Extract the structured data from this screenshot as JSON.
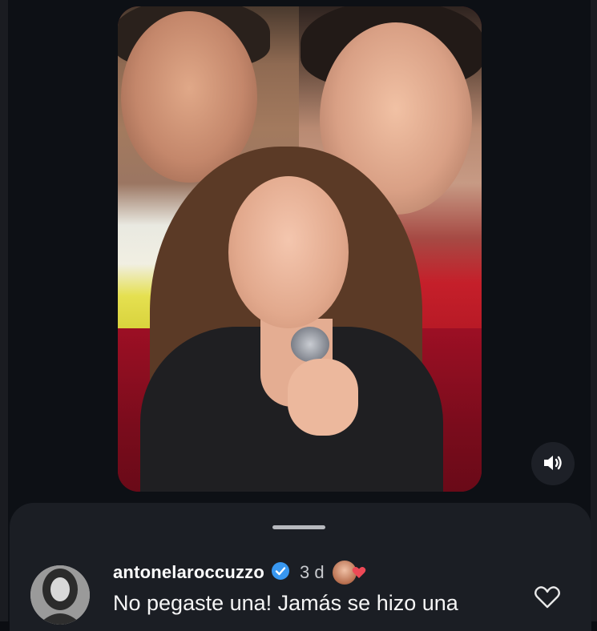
{
  "comment": {
    "username": "antonelaroccuzzo",
    "time": "3 d",
    "text": "No pegaste una! Jamás se hizo una"
  },
  "icons": {
    "sound": "speaker-icon",
    "verified": "verified-badge-icon",
    "like": "heart-outline-icon",
    "reaction": "heart-icon"
  },
  "colors": {
    "background": "#0d1015",
    "sheet": "#1b1e24",
    "verified": "#3897f0",
    "reaction_heart": "#ed4956"
  }
}
